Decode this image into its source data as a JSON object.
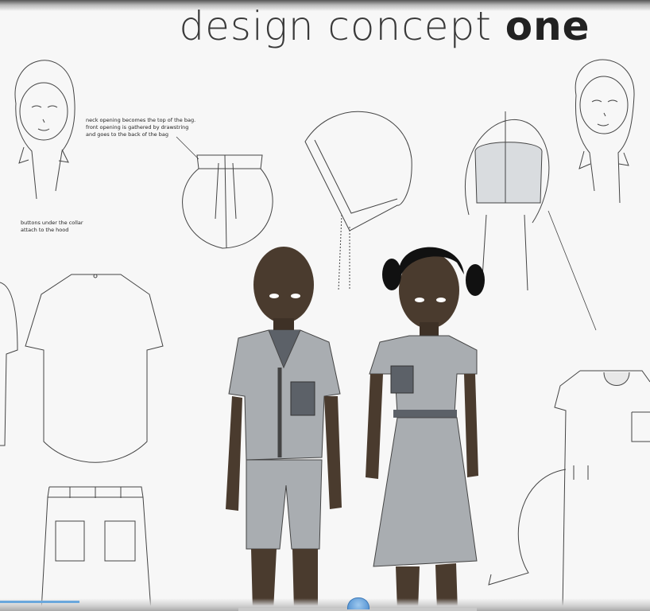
{
  "title": {
    "part1": "design concept",
    "part2": "one"
  },
  "notes": {
    "bag": [
      "neck opening becomes the top of the bag.",
      "front opening is gathered by drawstring",
      "and goes to the back of the bag"
    ],
    "buttons": [
      "buttons under the collar",
      "attach to the hood"
    ]
  },
  "colors": {
    "fabric": "#a9adb1",
    "pocket": "#5c6168",
    "skin": "#4a3b2e",
    "line": "#444444",
    "accent": "#4f8fd0"
  },
  "icons": [
    "video-scrubber-icon"
  ]
}
